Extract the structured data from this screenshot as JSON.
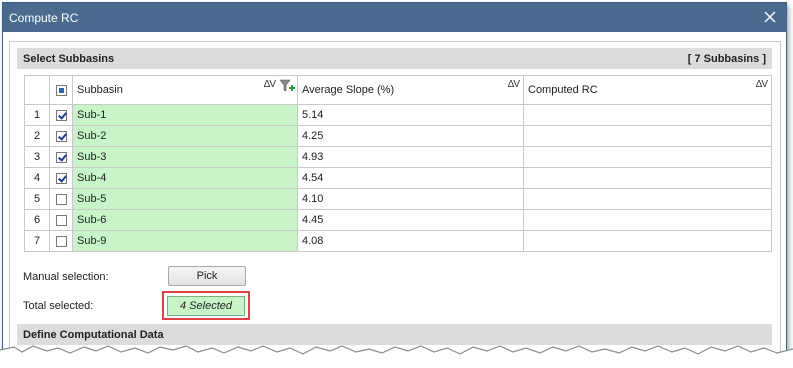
{
  "window": {
    "title": "Compute RC"
  },
  "section1": {
    "title": "Select Subbasins",
    "count": "[ 7 Subbasins ]"
  },
  "grid": {
    "columns": [
      "Subbasin",
      "Average Slope (%)",
      "Computed RC"
    ],
    "sort_glyph": "ΔV",
    "rows": [
      {
        "num": "1",
        "checked": true,
        "name": "Sub-1",
        "slope": "5.14",
        "rc": ""
      },
      {
        "num": "2",
        "checked": true,
        "name": "Sub-2",
        "slope": "4.25",
        "rc": ""
      },
      {
        "num": "3",
        "checked": true,
        "name": "Sub-3",
        "slope": "4.93",
        "rc": ""
      },
      {
        "num": "4",
        "checked": true,
        "name": "Sub-4",
        "slope": "4.54",
        "rc": ""
      },
      {
        "num": "5",
        "checked": false,
        "name": "Sub-5",
        "slope": "4.10",
        "rc": ""
      },
      {
        "num": "6",
        "checked": false,
        "name": "Sub-6",
        "slope": "4.45",
        "rc": ""
      },
      {
        "num": "7",
        "checked": false,
        "name": "Sub-9",
        "slope": "4.08",
        "rc": ""
      }
    ]
  },
  "manual_selection": {
    "label": "Manual selection:",
    "button": "Pick"
  },
  "total_selected": {
    "label": "Total selected:",
    "value": "4 Selected"
  },
  "section2": {
    "title": "Define Computational Data"
  },
  "colors": {
    "titlebar": "#4a6b8f",
    "green_cell": "#c8f5c8",
    "highlight": "#e04040"
  },
  "icons": {
    "close": "close-icon",
    "filter": "filter-add-icon",
    "sort": "sort-icon"
  }
}
